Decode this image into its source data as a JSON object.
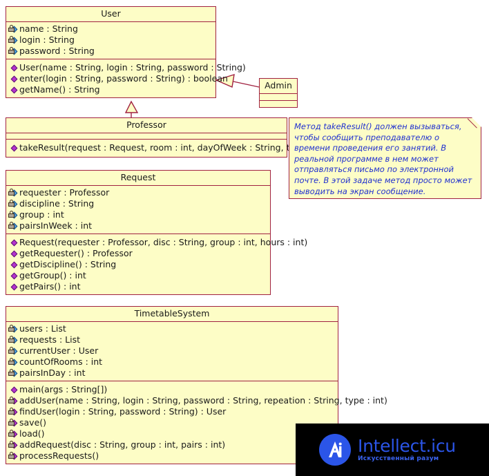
{
  "diagram": {
    "kind": "uml-class-diagram",
    "colors": {
      "class_fill": "#fdfdc6",
      "class_border": "#a02040",
      "note_text": "#2030d0",
      "attr_icon": "#4a9ee0",
      "method_icon": "#b634cf",
      "watermark_bg": "#000000",
      "watermark_accent": "#2b55e8"
    }
  },
  "classes": {
    "user": {
      "name": "User",
      "attributes": [
        {
          "visibility": "private",
          "label": "name : String"
        },
        {
          "visibility": "private",
          "label": "login : String"
        },
        {
          "visibility": "private",
          "label": "password : String"
        }
      ],
      "methods": [
        {
          "visibility": "public",
          "label": "User(name : String, login : String, password : String)"
        },
        {
          "visibility": "public",
          "label": "enter(login : String, password : String) : boolean"
        },
        {
          "visibility": "public",
          "label": "getName() : String"
        }
      ]
    },
    "admin": {
      "name": "Admin",
      "attributes": [],
      "methods": []
    },
    "professor": {
      "name": "Professor",
      "attributes": [],
      "methods": [
        {
          "visibility": "public",
          "label": "takeResult(request : Request, room : int, dayOfWeek : String, time : int)"
        }
      ]
    },
    "request": {
      "name": "Request",
      "attributes": [
        {
          "visibility": "private",
          "label": "requester : Professor"
        },
        {
          "visibility": "private",
          "label": "discipline : String"
        },
        {
          "visibility": "private",
          "label": "group : int"
        },
        {
          "visibility": "private",
          "label": "pairsInWeek : int"
        }
      ],
      "methods": [
        {
          "visibility": "public",
          "label": "Request(requester : Professor, disc : String, group : int, hours : int)"
        },
        {
          "visibility": "public",
          "label": "getRequester() : Professor"
        },
        {
          "visibility": "public",
          "label": "getDiscipline() : String"
        },
        {
          "visibility": "public",
          "label": "getGroup() : int"
        },
        {
          "visibility": "public",
          "label": "getPairs() : int"
        }
      ]
    },
    "timetablesystem": {
      "name": "TimetableSystem",
      "attributes": [
        {
          "visibility": "private",
          "label": "users : List"
        },
        {
          "visibility": "private",
          "label": "requests : List"
        },
        {
          "visibility": "private",
          "label": "currentUser : User"
        },
        {
          "visibility": "private",
          "label": "countOfRooms : int"
        },
        {
          "visibility": "private",
          "label": "pairsInDay : int"
        }
      ],
      "methods": [
        {
          "visibility": "public",
          "label": "main(args : String[])"
        },
        {
          "visibility": "private",
          "label": "addUser(name : String, login : String, password : String, repeation : String, type : int)"
        },
        {
          "visibility": "private",
          "label": "findUser(login : String, password : String) : User"
        },
        {
          "visibility": "private",
          "label": "save()"
        },
        {
          "visibility": "private",
          "label": "load()"
        },
        {
          "visibility": "private",
          "label": "addRequest(disc : String, group : int, pairs : int)"
        },
        {
          "visibility": "private",
          "label": "processRequests()"
        }
      ]
    }
  },
  "note": {
    "text": "Метод takeResult() должен вызываться, чтобы сообщить преподавателю о времени проведения его занятий. В реальной программе в нем может отправляться письмо по электронной почте. В этой задаче метод просто может выводить на экран сообщение."
  },
  "relations": [
    {
      "type": "generalization",
      "from": "Admin",
      "to": "User"
    },
    {
      "type": "generalization",
      "from": "Professor",
      "to": "User"
    }
  ],
  "watermark": {
    "logo_text": "Ai",
    "title": "Intellect.icu",
    "subtitle": "Искусственный разум"
  }
}
